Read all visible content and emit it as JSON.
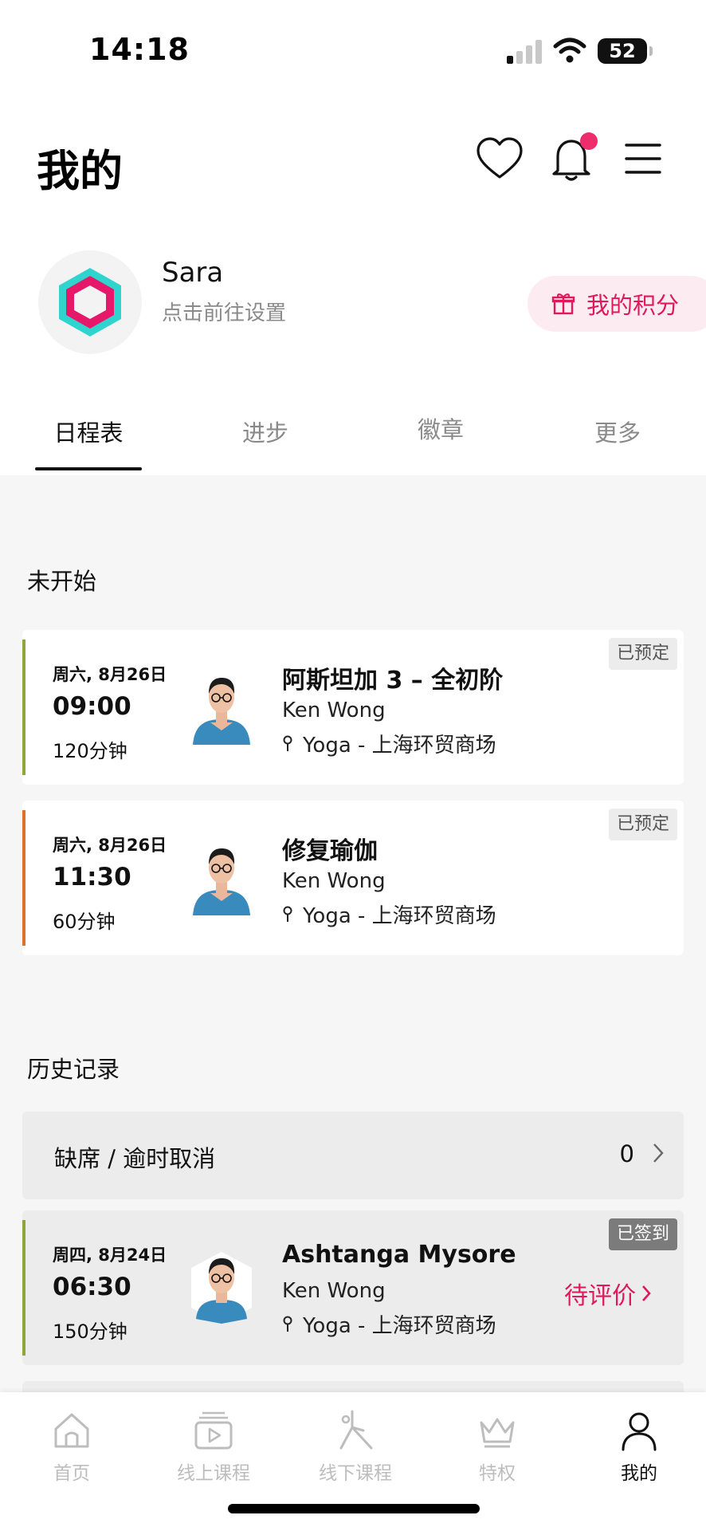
{
  "status_bar": {
    "time": "14:18",
    "battery": "52"
  },
  "header": {
    "title": "我的"
  },
  "profile": {
    "name": "Sara",
    "subtitle": "点击前往设置",
    "points_label": "我的积分"
  },
  "tabs": [
    {
      "label": "日程表",
      "active": true
    },
    {
      "label": "进步",
      "active": false
    },
    {
      "label": "徽章",
      "active": false
    },
    {
      "label": "更多",
      "active": false
    }
  ],
  "upcoming": {
    "title": "未开始",
    "items": [
      {
        "date": "周六, 8月26日",
        "time": "09:00",
        "duration": "120分钟",
        "class_name": "阿斯坦加 3 – 全初阶",
        "coach": "Ken Wong",
        "location": "Yoga - 上海环贸商场",
        "status": "已预定",
        "stripe_color": "#8fa63a"
      },
      {
        "date": "周六, 8月26日",
        "time": "11:30",
        "duration": "60分钟",
        "class_name": "修复瑜伽",
        "coach": "Ken Wong",
        "location": "Yoga - 上海环贸商场",
        "status": "已预定",
        "stripe_color": "#e2702d"
      }
    ]
  },
  "history": {
    "title": "历史记录",
    "absence_label": "缺席 / 逾时取消",
    "absence_count": "0",
    "items": [
      {
        "date": "周四, 8月24日",
        "time": "06:30",
        "duration": "150分钟",
        "class_name": "Ashtanga Mysore",
        "coach": "Ken Wong",
        "location": "Yoga - 上海环贸商场",
        "status": "已签到",
        "action": "待评价",
        "stripe_color": "#8fa63a"
      }
    ]
  },
  "bottom_nav": [
    {
      "label": "首页",
      "icon": "home-icon",
      "active": false
    },
    {
      "label": "线上课程",
      "icon": "video-icon",
      "active": false
    },
    {
      "label": "线下课程",
      "icon": "yoga-pose-icon",
      "active": false
    },
    {
      "label": "特权",
      "icon": "crown-icon",
      "active": false
    },
    {
      "label": "我的",
      "icon": "person-icon",
      "active": true
    }
  ],
  "colors": {
    "accent": "#e0195c",
    "notification_dot": "#ee2d6d",
    "logo_teal": "#2fd4cf",
    "logo_pink": "#e6186a"
  }
}
